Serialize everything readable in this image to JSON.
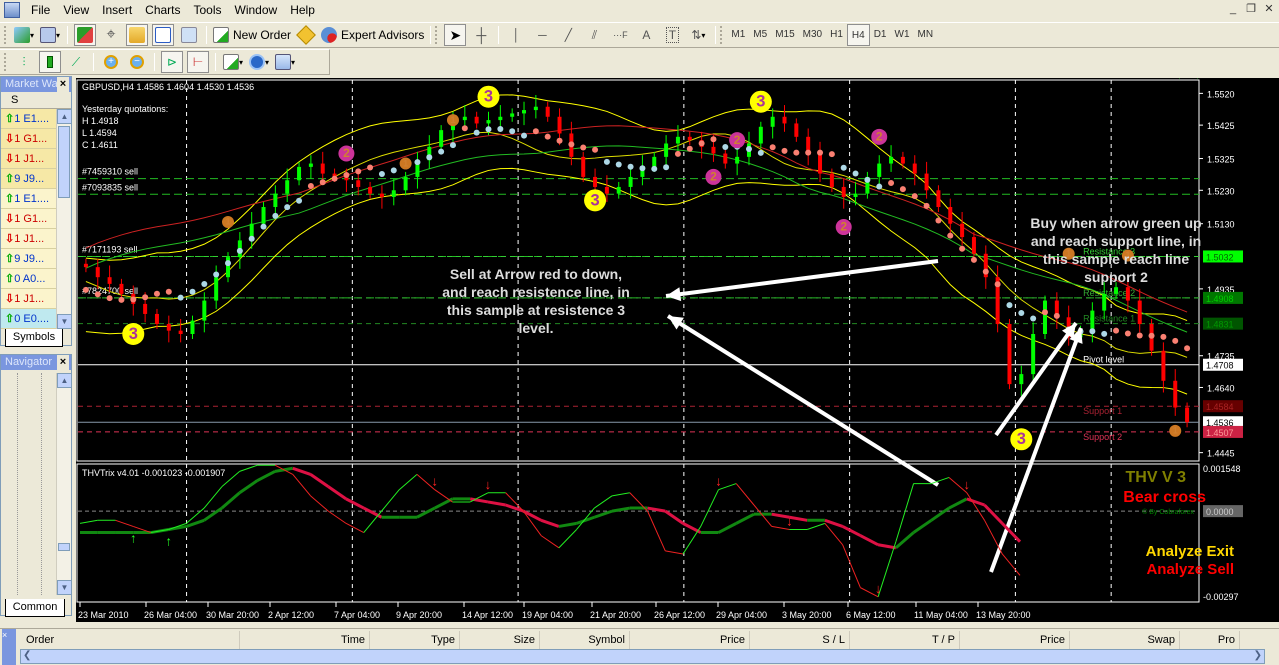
{
  "menubar": {
    "items": [
      "File",
      "View",
      "Insert",
      "Charts",
      "Tools",
      "Window",
      "Help"
    ],
    "window_buttons": [
      "_",
      "❐",
      "✕"
    ]
  },
  "toolbar1": {
    "new_order": "New Order",
    "expert_advisors": "Expert Advisors",
    "timeframes": [
      "M1",
      "M5",
      "M15",
      "M30",
      "H1",
      "H4",
      "D1",
      "W1",
      "MN"
    ],
    "active_timeframe": "H4",
    "drawing_tools": [
      "cursor",
      "crosshair",
      "vertical-line",
      "horizontal-line",
      "trendline",
      "fan",
      "fibonacci",
      "text",
      "label",
      "arrows"
    ]
  },
  "market_watch": {
    "title": "Market Wa",
    "column": "S",
    "rows": [
      {
        "dir": "up",
        "text": "1 E1...."
      },
      {
        "dir": "down",
        "text": "1 G1..."
      },
      {
        "dir": "down",
        "text": "1 J1..."
      },
      {
        "dir": "up",
        "text": "9 J9..."
      },
      {
        "dir": "up",
        "text": "1 E1...."
      },
      {
        "dir": "down",
        "text": "1 G1..."
      },
      {
        "dir": "down",
        "text": "1 J1..."
      },
      {
        "dir": "up",
        "text": "9 J9..."
      },
      {
        "dir": "up",
        "text": "0 A0..."
      },
      {
        "dir": "down",
        "text": "1 J1..."
      },
      {
        "dir": "up",
        "text": "0 E0...."
      }
    ],
    "tab": "Symbols"
  },
  "navigator": {
    "title": "Navigator",
    "tab": "Common"
  },
  "terminal": {
    "columns": [
      "Order",
      "Time",
      "Type",
      "Size",
      "Symbol",
      "Price",
      "S / L",
      "T / P",
      "Price",
      "Swap",
      "Pro"
    ]
  },
  "colors": {
    "bull_candle": "#00ff00",
    "bear_candle": "#ff0000",
    "blue_dots": "#add8e6",
    "salmon_dots": "#fa8072",
    "bands": "#ffff00",
    "resistance": "#00cc00",
    "support": "#cc2244"
  },
  "chart_data": [
    {
      "type": "candlestick",
      "title": "GBPUSD,H4  1.4586 1.4604 1.4530 1.4536",
      "symbol": "GBPUSD",
      "timeframe": "H4",
      "ohlc_last": {
        "open": 1.4586,
        "high": 1.4604,
        "low": 1.453,
        "close": 1.4536
      },
      "yesterday": {
        "label": "Yesterday quotations:",
        "H": "H 1.4918",
        "L": "L 1.4594",
        "C": "C 1.4611"
      },
      "ylim": [
        1.442,
        1.556
      ],
      "y_ticks": [
        1.552,
        1.5425,
        1.5325,
        1.523,
        1.513,
        1.4935,
        1.4735,
        1.464,
        1.4445
      ],
      "y_tick_labels": [
        "1.5520",
        "1.5425",
        "1.5325",
        "1.5230",
        "1.5130",
        "1.4935",
        "1.4735",
        "1.4640",
        "1.4445"
      ],
      "price_tags": [
        {
          "value": 1.5032,
          "label": "1.5032",
          "bg": "#00ff00",
          "fg": "#006600"
        },
        {
          "value": 1.4908,
          "label": "1.4908",
          "bg": "#007700",
          "fg": "#00cc00"
        },
        {
          "value": 1.4831,
          "label": "1.4831",
          "bg": "#005500",
          "fg": "#009900"
        },
        {
          "value": 1.4708,
          "label": "1.4708",
          "bg": "#ffffff",
          "fg": "#000000"
        },
        {
          "value": 1.4584,
          "label": "1.4584",
          "bg": "#660000",
          "fg": "#aa2222"
        },
        {
          "value": 1.4536,
          "label": "1.4536",
          "bg": "#ffffff",
          "fg": "#000000"
        },
        {
          "value": 1.4507,
          "label": "1.4507",
          "bg": "#cc2244",
          "fg": "#ff9999"
        }
      ],
      "x_labels": [
        "23 Mar 2010",
        "26 Mar 04:00",
        "30 Mar 20:00",
        "2 Apr 12:00",
        "7 Apr 04:00",
        "9 Apr 20:00",
        "14 Apr 12:00",
        "19 Apr 04:00",
        "21 Apr 20:00",
        "26 Apr 12:00",
        "29 Apr 04:00",
        "3 May 20:00",
        "6 May 12:00",
        "11 May 04:00",
        "13 May 20:00"
      ],
      "levels": [
        {
          "name": "Resistance 3",
          "value": 1.5032,
          "color": "#33cc33"
        },
        {
          "name": "Resistance 2",
          "value": 1.4908,
          "color": "#33aa33"
        },
        {
          "name": "Resistance 1",
          "value": 1.4831,
          "color": "#228822"
        },
        {
          "name": "Pivot level",
          "value": 1.4708,
          "color": "#ffffff"
        },
        {
          "name": "Support 1",
          "value": 1.4584,
          "color": "#aa2233"
        },
        {
          "name": "Support 2",
          "value": 1.4507,
          "color": "#dd3355"
        }
      ],
      "orders": [
        {
          "label": "#7459310 sell",
          "value": 1.5265
        },
        {
          "label": "#7093835 sell",
          "value": 1.5218
        },
        {
          "label": "#7171193 sell",
          "value": 1.5032
        },
        {
          "label": "#7824700 sell",
          "value": 1.4908
        }
      ],
      "close_path": [
        1.5,
        1.497,
        1.495,
        1.492,
        1.489,
        1.486,
        1.483,
        1.481,
        1.48,
        1.484,
        1.49,
        1.497,
        1.503,
        1.508,
        1.513,
        1.518,
        1.522,
        1.526,
        1.53,
        1.531,
        1.528,
        1.527,
        1.526,
        1.524,
        1.522,
        1.521,
        1.523,
        1.527,
        1.532,
        1.536,
        1.541,
        1.544,
        1.545,
        1.543,
        1.544,
        1.545,
        1.546,
        1.547,
        1.548,
        1.545,
        1.54,
        1.533,
        1.527,
        1.524,
        1.522,
        1.524,
        1.527,
        1.53,
        1.533,
        1.537,
        1.539,
        1.538,
        1.536,
        1.534,
        1.531,
        1.533,
        1.537,
        1.542,
        1.545,
        1.543,
        1.539,
        1.534,
        1.528,
        1.524,
        1.521,
        1.522,
        1.527,
        1.531,
        1.533,
        1.531,
        1.528,
        1.523,
        1.518,
        1.513,
        1.509,
        1.504,
        1.497,
        1.483,
        1.465,
        1.468,
        1.48,
        1.49,
        1.485,
        1.479,
        1.481,
        1.487,
        1.492,
        1.494,
        1.49,
        1.483,
        1.475,
        1.466,
        1.458,
        1.4536
      ],
      "fractal_markers": [
        {
          "label": "3",
          "color": "#ffff00",
          "at": 4,
          "value": 1.48,
          "pos": "below"
        },
        {
          "label": "3",
          "color": "#ffff00",
          "at": 34,
          "value": 1.551,
          "pos": "above"
        },
        {
          "label": "3",
          "color": "#ffff00",
          "at": 43,
          "value": 1.52,
          "pos": "below"
        },
        {
          "label": "3",
          "color": "#ffff00",
          "at": 57,
          "value": 1.5495,
          "pos": "above"
        },
        {
          "label": "3",
          "color": "#ffff00",
          "at": 79,
          "value": 1.4485,
          "pos": "below"
        },
        {
          "label": "2",
          "color": "#cc3399",
          "at": 22,
          "value": 1.534,
          "pos": "above"
        },
        {
          "label": "2",
          "color": "#cc3399",
          "at": 55,
          "value": 1.538,
          "pos": "above"
        },
        {
          "label": "2",
          "color": "#cc3399",
          "at": 53,
          "value": 1.527,
          "pos": "below"
        },
        {
          "label": "2",
          "color": "#cc3399",
          "at": 67,
          "value": 1.539,
          "pos": "above"
        },
        {
          "label": "2",
          "color": "#cc3399",
          "at": 64,
          "value": 1.512,
          "pos": "below"
        },
        {
          "label": "1",
          "color": "#cc7722",
          "at": 31,
          "value": 1.544,
          "pos": "above"
        },
        {
          "label": "1",
          "color": "#cc7722",
          "at": 27,
          "value": 1.531,
          "pos": "below"
        },
        {
          "label": "1",
          "color": "#cc7722",
          "at": 12,
          "value": 1.5135,
          "pos": "above"
        },
        {
          "label": "1",
          "color": "#cc7722",
          "at": 88,
          "value": 1.5035,
          "pos": "above"
        },
        {
          "label": "1",
          "color": "#cc7722",
          "at": 83,
          "value": 1.504,
          "pos": "above"
        },
        {
          "label": "1",
          "color": "#cc7722",
          "at": 92,
          "value": 1.451,
          "pos": "below"
        }
      ],
      "annotations": [
        {
          "text": [
            "Sell at Arrow red to down,",
            "and reach resistence line, in",
            "this sample at resistence 3",
            "level."
          ]
        },
        {
          "text": [
            "Buy when arrow green up",
            "and reach support line, in",
            "this sample reach line",
            "support 2"
          ]
        }
      ]
    },
    {
      "type": "line",
      "title": "THVTrix v4.01 -0.001023 -0.001907",
      "ylim": [
        -0.00297,
        0.00154
      ],
      "y_tick_labels": [
        "0.001548",
        "0.0000",
        "-0.00297"
      ],
      "zero_line": 0.0,
      "series": [
        {
          "name": "trix_fast",
          "values": [
            -0.0004,
            -0.0003,
            -0.0003,
            -0.0005,
            -0.0007,
            -0.0006,
            -0.0004,
            0.0001,
            0.0008,
            0.0013,
            0.0015,
            0.0015,
            0.0012,
            0.0005,
            0.0,
            -0.0004,
            -0.0007,
            0.0,
            0.0007,
            0.0012,
            0.0007,
            0.0003,
            0.0003,
            0.0006,
            0.0006,
            0.0,
            -0.0008,
            -0.0012,
            -0.0006,
            0.0001,
            0.0005,
            0.0006,
            0.0,
            -0.0013,
            -0.0014,
            -0.0005,
            0.0007,
            0.0009,
            0.0002,
            -0.0005,
            -0.0006,
            -0.0006,
            -0.0004,
            -0.0011,
            -0.0025,
            -0.0028,
            -0.001,
            0.0009,
            0.0009,
            0.0011,
            0.0006,
            -0.0003,
            -0.0014,
            -0.0021
          ]
        },
        {
          "name": "trix_slow",
          "values": [
            -0.0007,
            -0.0007,
            -0.0007,
            -0.0007,
            -0.0007,
            -0.0006,
            -0.0005,
            -0.0003,
            0.0001,
            0.0006,
            0.001,
            0.0013,
            0.0014,
            0.0012,
            0.0008,
            0.0004,
            0.0001,
            -0.0002,
            -0.0002,
            -0.0002,
            0.0001,
            0.0004,
            0.0004,
            0.0003,
            0.0002,
            0.0,
            -0.0003,
            -0.0005,
            -0.0004,
            -0.0002,
            0.0,
            0.0001,
            0.0001,
            0.0,
            -0.0004,
            -0.0007,
            -0.0007,
            -0.0004,
            -0.0001,
            -0.0001,
            -0.0002,
            -0.0003,
            -0.0003,
            -0.0005,
            -0.0008,
            -0.0011,
            -0.0012,
            -0.0007,
            -0.0003,
            0.0001,
            0.0004,
            0.0002,
            -0.0004,
            -0.001
          ]
        }
      ],
      "signals": [
        {
          "type": "up",
          "at": 3
        },
        {
          "type": "up",
          "at": 5
        },
        {
          "type": "down",
          "at": 20
        },
        {
          "type": "down",
          "at": 23
        },
        {
          "type": "down",
          "at": 36
        },
        {
          "type": "down",
          "at": 40
        },
        {
          "type": "down",
          "at": 45
        },
        {
          "type": "down",
          "at": 50
        },
        {
          "type": "up",
          "at": 62
        },
        {
          "type": "up",
          "at": 63
        },
        {
          "type": "down",
          "at": 72
        },
        {
          "type": "up",
          "at": 80
        }
      ],
      "legend_texts": [
        {
          "text": "THV V 3",
          "color": "#808000"
        },
        {
          "text": "Bear cross",
          "color": "#ff0000"
        },
        {
          "text": "© By Cobraforex",
          "color": "#008800"
        },
        {
          "text": "Analyze Exit",
          "color": "#ffd700"
        },
        {
          "text": "Analyze Sell",
          "color": "#ff0000"
        }
      ]
    }
  ]
}
